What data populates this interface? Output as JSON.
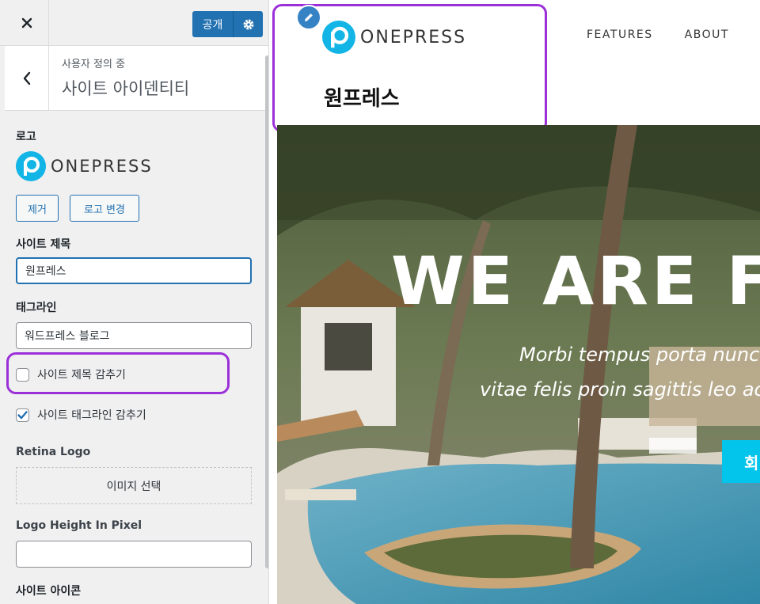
{
  "topbar": {
    "close_icon": "close-icon",
    "publish_label": "공개",
    "settings_icon": "gear-icon"
  },
  "section": {
    "subtitle": "사용자 정의 중",
    "title": "사이트 아이덴티티",
    "back_icon": "chevron-left-icon"
  },
  "logo_control": {
    "label": "로고",
    "logo_text": "ONEPRESS",
    "remove_label": "제거",
    "change_label": "로고 변경"
  },
  "site_title_control": {
    "label": "사이트 제목",
    "value": "원프레스"
  },
  "tagline_control": {
    "label": "태그라인",
    "value": "워드프레스 블로그"
  },
  "checkboxes": {
    "hide_title": {
      "label": "사이트 제목 감추기",
      "checked": false
    },
    "hide_tagline": {
      "label": "사이트 태그라인 감추기",
      "checked": true
    }
  },
  "retina_logo": {
    "label": "Retina Logo",
    "button": "이미지 선택"
  },
  "logo_height": {
    "label": "Logo Height In Pixel",
    "value": ""
  },
  "site_icon": {
    "label": "사이트 아이콘"
  },
  "preview": {
    "logo_text": "ONEPRESS",
    "site_title": "원프레스",
    "nav": [
      "FEATURES",
      "ABOUT"
    ],
    "hero_headline": "WE ARE F",
    "hero_line1": "Morbi tempus porta nunc p",
    "hero_line2": "vitae felis proin sagittis leo ac te",
    "hero_button": "회"
  },
  "colors": {
    "accent": "#2271b1",
    "highlight": "#9b30d9",
    "brand_cyan": "#03c4eb"
  }
}
